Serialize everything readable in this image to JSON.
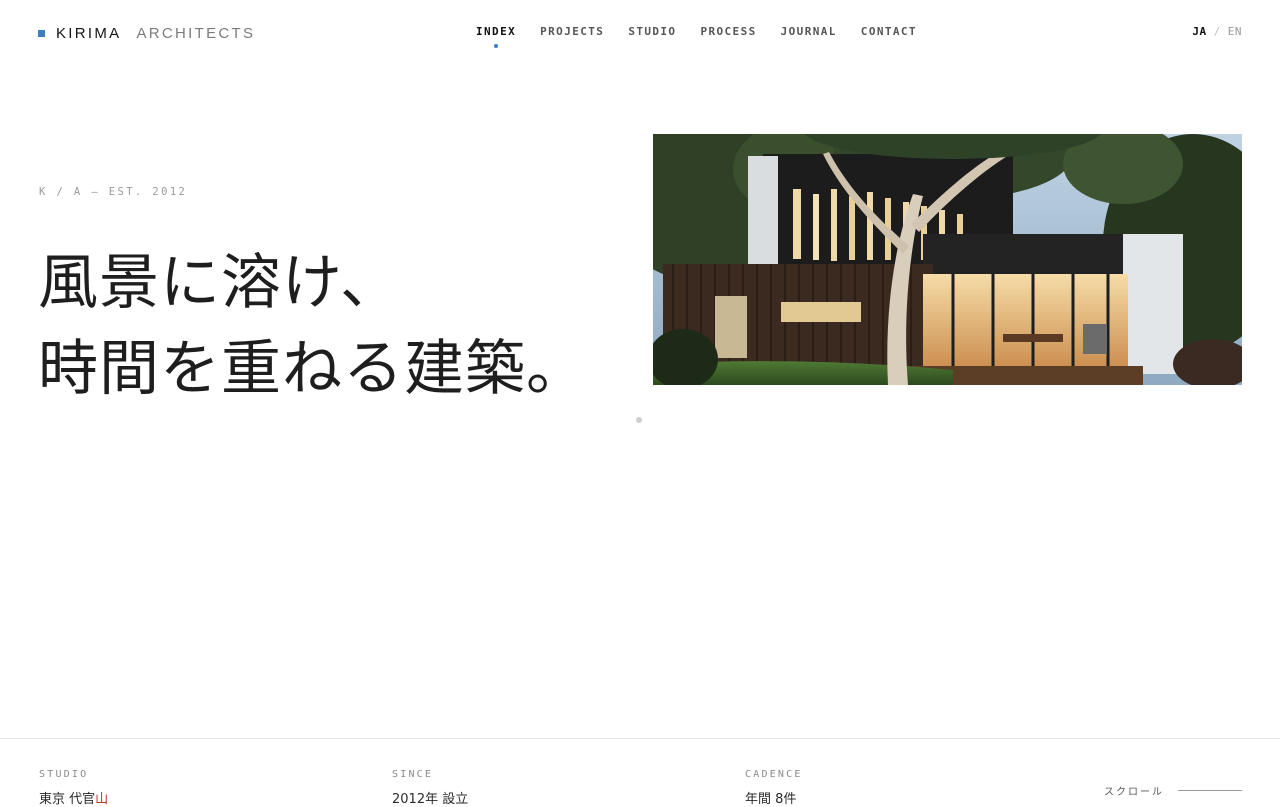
{
  "brand": {
    "name": "KIRIMA",
    "subtitle": "ARCHITECTS",
    "accent_color": "#3d7fc1"
  },
  "nav": {
    "items": [
      {
        "label": "INDEX",
        "active": true
      },
      {
        "label": "PROJECTS",
        "active": false
      },
      {
        "label": "STUDIO",
        "active": false
      },
      {
        "label": "PROCESS",
        "active": false
      },
      {
        "label": "JOURNAL",
        "active": false
      },
      {
        "label": "CONTACT",
        "active": false
      }
    ]
  },
  "language": {
    "current": "JA",
    "separator": "/",
    "other": "EN"
  },
  "hero": {
    "eyebrow": "K / A — EST. 2012",
    "headline_line1": "風景に溶け、",
    "headline_line2": "時間を重ねる建築。",
    "image_icon": "house-photo-icon"
  },
  "stats": [
    {
      "label": "STUDIO",
      "value_main": "東京 代官",
      "value_accent": "山"
    },
    {
      "label": "SINCE",
      "value_main": "2012年 設立",
      "value_accent": ""
    },
    {
      "label": "CADENCE",
      "value_main": "年間 8件",
      "value_accent": ""
    }
  ],
  "scroll": {
    "label": "スクロール"
  }
}
